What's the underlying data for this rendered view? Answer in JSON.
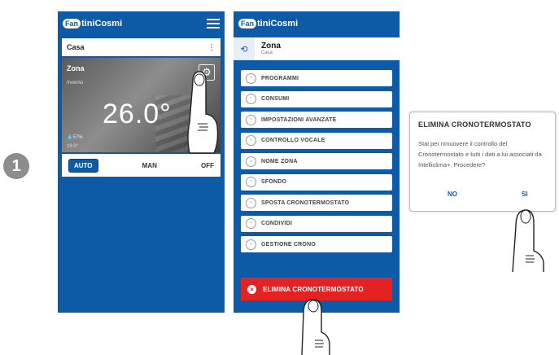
{
  "step": {
    "number": "1"
  },
  "screen1": {
    "logo": {
      "brand": "FantiniCosmi",
      "badge": "Fan",
      "rest": "tiniCosmi"
    },
    "home_name": "Casa",
    "home_menu_icon": "⋮",
    "zone": {
      "name": "Zona",
      "subtitle": "Inverno",
      "temperature": "26.0°",
      "humidity": "💧57%",
      "external": "18.0°"
    },
    "modes": {
      "auto": "AUTO",
      "man": "MAN",
      "off": "OFF"
    },
    "icons": [
      "menu-icon",
      "gear-icon",
      "pointer-hand-icon"
    ]
  },
  "screen2": {
    "logo": {
      "brand": "FantiniCosmi",
      "badge": "Fan",
      "rest": "tiniCosmi"
    },
    "header": {
      "title": "Zona",
      "subtitle": "Casa",
      "back_icon": "⟲"
    },
    "menu": [
      {
        "label": "PROGRAMMI"
      },
      {
        "label": "CONSUMI"
      },
      {
        "label": "IMPOSTAZIONI AVANZATE"
      },
      {
        "label": "CONTROLLO VOCALE"
      },
      {
        "label": "NOME ZONA"
      },
      {
        "label": "SFONDO"
      },
      {
        "label": "SPOSTA CRONOTERMOSTATO"
      },
      {
        "label": "CONDIVIDI"
      },
      {
        "label": "GESTIONE CRONO"
      }
    ],
    "delete_label": "ELIMINA CRONOTERMOSTATO",
    "delete_icon": "×",
    "chevron_icon": "›"
  },
  "dialog": {
    "title": "ELIMINA CRONOTERMOSTATO",
    "body": "Stai per rimuovere il controllo del Cronotermostato e tutti i dati a lui associati da Intelliclima+. Procedere?",
    "no": "NO",
    "yes": "SI"
  },
  "colors": {
    "brand_blue": "#0d5aa7",
    "danger_red": "#e42222"
  }
}
